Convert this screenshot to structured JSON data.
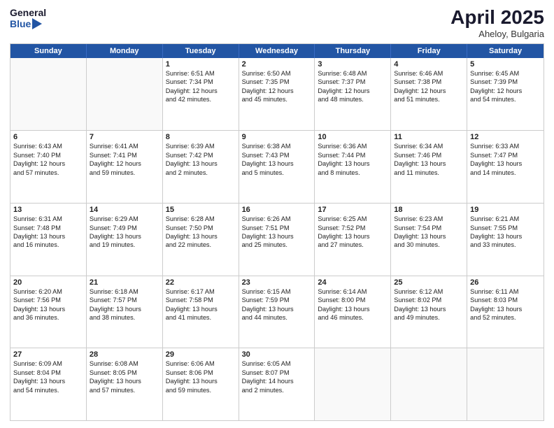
{
  "header": {
    "logo_line1": "General",
    "logo_line2": "Blue",
    "month": "April 2025",
    "location": "Aheloy, Bulgaria"
  },
  "day_headers": [
    "Sunday",
    "Monday",
    "Tuesday",
    "Wednesday",
    "Thursday",
    "Friday",
    "Saturday"
  ],
  "weeks": [
    [
      {
        "num": "",
        "info": ""
      },
      {
        "num": "",
        "info": ""
      },
      {
        "num": "1",
        "info": "Sunrise: 6:51 AM\nSunset: 7:34 PM\nDaylight: 12 hours\nand 42 minutes."
      },
      {
        "num": "2",
        "info": "Sunrise: 6:50 AM\nSunset: 7:35 PM\nDaylight: 12 hours\nand 45 minutes."
      },
      {
        "num": "3",
        "info": "Sunrise: 6:48 AM\nSunset: 7:37 PM\nDaylight: 12 hours\nand 48 minutes."
      },
      {
        "num": "4",
        "info": "Sunrise: 6:46 AM\nSunset: 7:38 PM\nDaylight: 12 hours\nand 51 minutes."
      },
      {
        "num": "5",
        "info": "Sunrise: 6:45 AM\nSunset: 7:39 PM\nDaylight: 12 hours\nand 54 minutes."
      }
    ],
    [
      {
        "num": "6",
        "info": "Sunrise: 6:43 AM\nSunset: 7:40 PM\nDaylight: 12 hours\nand 57 minutes."
      },
      {
        "num": "7",
        "info": "Sunrise: 6:41 AM\nSunset: 7:41 PM\nDaylight: 12 hours\nand 59 minutes."
      },
      {
        "num": "8",
        "info": "Sunrise: 6:39 AM\nSunset: 7:42 PM\nDaylight: 13 hours\nand 2 minutes."
      },
      {
        "num": "9",
        "info": "Sunrise: 6:38 AM\nSunset: 7:43 PM\nDaylight: 13 hours\nand 5 minutes."
      },
      {
        "num": "10",
        "info": "Sunrise: 6:36 AM\nSunset: 7:44 PM\nDaylight: 13 hours\nand 8 minutes."
      },
      {
        "num": "11",
        "info": "Sunrise: 6:34 AM\nSunset: 7:46 PM\nDaylight: 13 hours\nand 11 minutes."
      },
      {
        "num": "12",
        "info": "Sunrise: 6:33 AM\nSunset: 7:47 PM\nDaylight: 13 hours\nand 14 minutes."
      }
    ],
    [
      {
        "num": "13",
        "info": "Sunrise: 6:31 AM\nSunset: 7:48 PM\nDaylight: 13 hours\nand 16 minutes."
      },
      {
        "num": "14",
        "info": "Sunrise: 6:29 AM\nSunset: 7:49 PM\nDaylight: 13 hours\nand 19 minutes."
      },
      {
        "num": "15",
        "info": "Sunrise: 6:28 AM\nSunset: 7:50 PM\nDaylight: 13 hours\nand 22 minutes."
      },
      {
        "num": "16",
        "info": "Sunrise: 6:26 AM\nSunset: 7:51 PM\nDaylight: 13 hours\nand 25 minutes."
      },
      {
        "num": "17",
        "info": "Sunrise: 6:25 AM\nSunset: 7:52 PM\nDaylight: 13 hours\nand 27 minutes."
      },
      {
        "num": "18",
        "info": "Sunrise: 6:23 AM\nSunset: 7:54 PM\nDaylight: 13 hours\nand 30 minutes."
      },
      {
        "num": "19",
        "info": "Sunrise: 6:21 AM\nSunset: 7:55 PM\nDaylight: 13 hours\nand 33 minutes."
      }
    ],
    [
      {
        "num": "20",
        "info": "Sunrise: 6:20 AM\nSunset: 7:56 PM\nDaylight: 13 hours\nand 36 minutes."
      },
      {
        "num": "21",
        "info": "Sunrise: 6:18 AM\nSunset: 7:57 PM\nDaylight: 13 hours\nand 38 minutes."
      },
      {
        "num": "22",
        "info": "Sunrise: 6:17 AM\nSunset: 7:58 PM\nDaylight: 13 hours\nand 41 minutes."
      },
      {
        "num": "23",
        "info": "Sunrise: 6:15 AM\nSunset: 7:59 PM\nDaylight: 13 hours\nand 44 minutes."
      },
      {
        "num": "24",
        "info": "Sunrise: 6:14 AM\nSunset: 8:00 PM\nDaylight: 13 hours\nand 46 minutes."
      },
      {
        "num": "25",
        "info": "Sunrise: 6:12 AM\nSunset: 8:02 PM\nDaylight: 13 hours\nand 49 minutes."
      },
      {
        "num": "26",
        "info": "Sunrise: 6:11 AM\nSunset: 8:03 PM\nDaylight: 13 hours\nand 52 minutes."
      }
    ],
    [
      {
        "num": "27",
        "info": "Sunrise: 6:09 AM\nSunset: 8:04 PM\nDaylight: 13 hours\nand 54 minutes."
      },
      {
        "num": "28",
        "info": "Sunrise: 6:08 AM\nSunset: 8:05 PM\nDaylight: 13 hours\nand 57 minutes."
      },
      {
        "num": "29",
        "info": "Sunrise: 6:06 AM\nSunset: 8:06 PM\nDaylight: 13 hours\nand 59 minutes."
      },
      {
        "num": "30",
        "info": "Sunrise: 6:05 AM\nSunset: 8:07 PM\nDaylight: 14 hours\nand 2 minutes."
      },
      {
        "num": "",
        "info": ""
      },
      {
        "num": "",
        "info": ""
      },
      {
        "num": "",
        "info": ""
      }
    ]
  ]
}
